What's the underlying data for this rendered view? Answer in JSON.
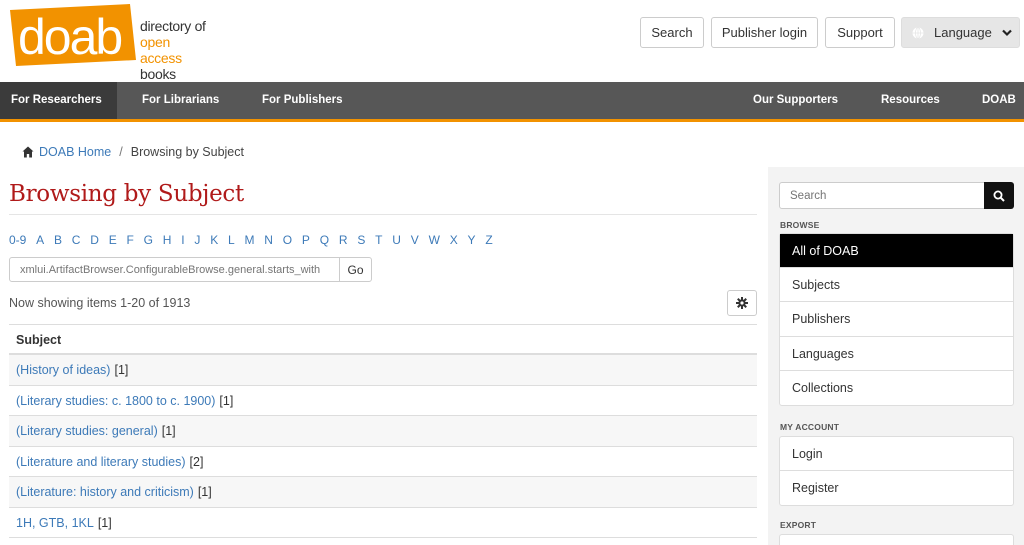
{
  "header": {
    "logo_word": "doab",
    "logo_line1": "directory of",
    "logo_line2": "open access",
    "logo_line3": "books",
    "search_label": "Search",
    "publisher_login_label": "Publisher login",
    "support_label": "Support",
    "language_label": "Language"
  },
  "nav": {
    "researchers": "For Researchers",
    "librarians": "For Librarians",
    "publishers": "For Publishers",
    "supporters": "Our Supporters",
    "resources": "Resources",
    "doab": "DOAB"
  },
  "breadcrumb": {
    "home": "DOAB Home",
    "separator": "/",
    "current": "Browsing by Subject"
  },
  "main": {
    "title": "Browsing by Subject",
    "letters": [
      "0-9",
      "A",
      "B",
      "C",
      "D",
      "E",
      "F",
      "G",
      "H",
      "I",
      "J",
      "K",
      "L",
      "M",
      "N",
      "O",
      "P",
      "Q",
      "R",
      "S",
      "T",
      "U",
      "V",
      "W",
      "X",
      "Y",
      "Z"
    ],
    "starts_with_placeholder": "xmlui.ArtifactBrowser.ConfigurableBrowse.general.starts_with",
    "go_label": "Go",
    "showing": "Now showing items 1-20 of 1913",
    "column_header": "Subject",
    "rows": [
      {
        "subject": "(History of ideas)",
        "count": "[1]"
      },
      {
        "subject": "(Literary studies: c. 1800 to c. 1900)",
        "count": "[1]"
      },
      {
        "subject": "(Literary studies: general)",
        "count": "[1]"
      },
      {
        "subject": "(Literature and literary studies)",
        "count": "[2]"
      },
      {
        "subject": "(Literature: history and criticism)",
        "count": "[1]"
      },
      {
        "subject": "1H, GTB, 1KL",
        "count": "[1]"
      }
    ]
  },
  "sidebar": {
    "search_placeholder": "Search",
    "browse_heading": "BROWSE",
    "browse_items": [
      "All of DOAB",
      "Subjects",
      "Publishers",
      "Languages",
      "Collections"
    ],
    "account_heading": "MY ACCOUNT",
    "account_items": [
      "Login",
      "Register"
    ],
    "export_heading": "EXPORT"
  },
  "colors": {
    "brand_orange": "#f29200",
    "title_red": "#b01a1a",
    "link_blue": "#3d7ab8",
    "nav_bg": "#575757"
  }
}
